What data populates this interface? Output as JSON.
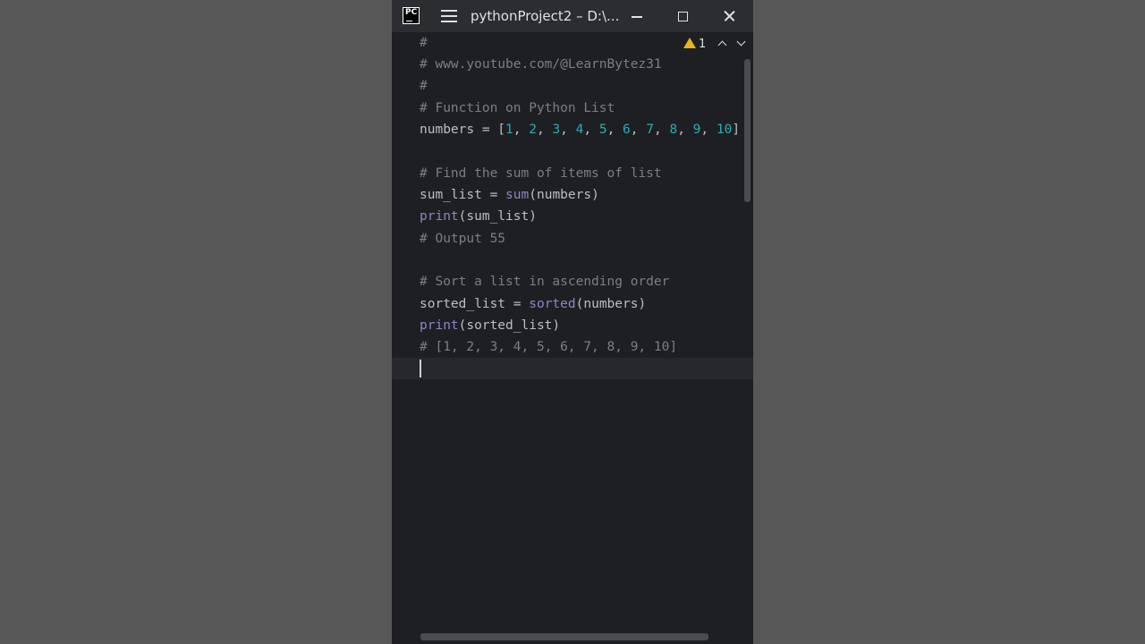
{
  "window": {
    "title": "pythonProject2 – D:\\...",
    "logo_text": "PC"
  },
  "inspection": {
    "warning_count": "1"
  },
  "code": {
    "l1": "#",
    "l2": "# www.youtube.com/@LearnBytez31",
    "l3": "#",
    "l4": "# Function on Python List",
    "l5_name": "numbers",
    "l5_op": " = [",
    "l5_items": [
      "1",
      "2",
      "3",
      "4",
      "5",
      "6",
      "7",
      "8",
      "9",
      "10"
    ],
    "l5_sep": ", ",
    "l5_close": "]",
    "l7": "# Find the sum of items of list",
    "l8_name": "sum_list",
    "l8_op": " = ",
    "l8_func": "sum",
    "l8_args": "(numbers)",
    "l9_func": "print",
    "l9_args": "(sum_list)",
    "l10": "# Output 55",
    "l12": "# Sort a list in ascending order",
    "l13_name": "sorted_list",
    "l13_op": " = ",
    "l13_func": "sorted",
    "l13_args": "(numbers)",
    "l14_func": "print",
    "l14_args": "(sorted_list)",
    "l15": "# [1, 2, 3, 4, 5, 6, 7, 8, 9, 10]"
  },
  "colors": {
    "editor_bg": "#1e1f22",
    "titlebar_bg": "#2b2d30",
    "comment": "#7a7e85",
    "number": "#2aacb8",
    "builtin": "#8888c6",
    "identifier": "#bcbec4",
    "warning": "#e6b422"
  }
}
